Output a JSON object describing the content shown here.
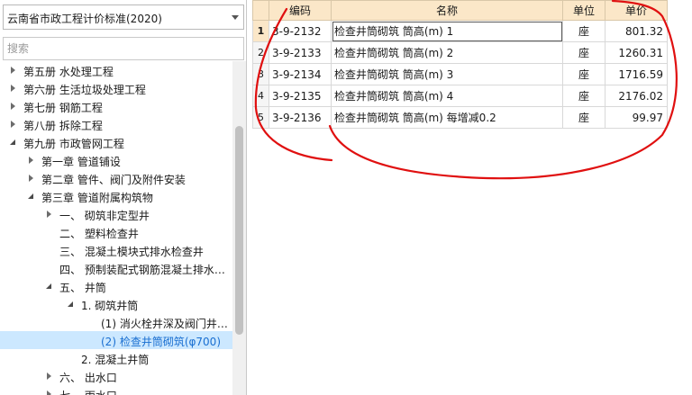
{
  "left_panel": {
    "standard_select": {
      "value": "云南省市政工程计价标准(2020)"
    },
    "search": {
      "placeholder": "搜索"
    },
    "tree": [
      {
        "label": "第五册  水处理工程",
        "state": "collapsed",
        "level": 0
      },
      {
        "label": "第六册  生活垃圾处理工程",
        "state": "collapsed",
        "level": 0
      },
      {
        "label": "第七册  钢筋工程",
        "state": "collapsed",
        "level": 0
      },
      {
        "label": "第八册  拆除工程",
        "state": "collapsed",
        "level": 0
      },
      {
        "label": "第九册  市政管网工程",
        "state": "expanded",
        "level": 0
      },
      {
        "label": "第一章  管道铺设",
        "state": "collapsed",
        "level": 1
      },
      {
        "label": "第二章  管件、阀门及附件安装",
        "state": "collapsed",
        "level": 1
      },
      {
        "label": "第三章  管道附属构筑物",
        "state": "expanded",
        "level": 1
      },
      {
        "label": "一、  砌筑非定型井",
        "state": "collapsed",
        "level": 2
      },
      {
        "label": "二、  塑料检查井",
        "state": "leaf",
        "level": 2
      },
      {
        "label": "三、  混凝土模块式排水检查井",
        "state": "leaf",
        "level": 2
      },
      {
        "label": "四、  预制装配式钢筋混凝土排水…",
        "state": "leaf",
        "level": 2
      },
      {
        "label": "五、  井筒",
        "state": "expanded",
        "level": 2
      },
      {
        "label": "1.  砌筑井筒",
        "state": "expanded",
        "level": 3
      },
      {
        "label": "(1)  消火栓井深及阀门井…",
        "state": "leaf",
        "level": 4
      },
      {
        "label": "(2)  检查井筒砌筑(φ700)",
        "state": "leaf",
        "level": 4,
        "selected": true
      },
      {
        "label": "2.  混凝土井筒",
        "state": "leaf",
        "level": 3
      },
      {
        "label": "六、  出水口",
        "state": "collapsed",
        "level": 2
      },
      {
        "label": "七、  雨水口",
        "state": "collapsed",
        "level": 2
      }
    ]
  },
  "grid": {
    "headers": {
      "code": "编码",
      "name": "名称",
      "unit": "单位",
      "price": "单价"
    },
    "rows": [
      {
        "num": "1",
        "code": "3-9-2132",
        "name": "检查井筒砌筑 筒高(m) 1",
        "unit": "座",
        "price": "801.32"
      },
      {
        "num": "2",
        "code": "3-9-2133",
        "name": "检查井筒砌筑 筒高(m) 2",
        "unit": "座",
        "price": "1260.31"
      },
      {
        "num": "3",
        "code": "3-9-2134",
        "name": "检查井筒砌筑 筒高(m) 3",
        "unit": "座",
        "price": "1716.59"
      },
      {
        "num": "4",
        "code": "3-9-2135",
        "name": "检查井筒砌筑 筒高(m) 4",
        "unit": "座",
        "price": "2176.02"
      },
      {
        "num": "5",
        "code": "3-9-2136",
        "name": "检查井筒砌筑 筒高(m) 每增减0.2",
        "unit": "座",
        "price": "99.97"
      }
    ]
  },
  "colors": {
    "header_bg": "#fbe7c8",
    "selected_bg": "#cce8ff",
    "selected_text": "#1a6fd1",
    "annotation": "#e01010"
  }
}
